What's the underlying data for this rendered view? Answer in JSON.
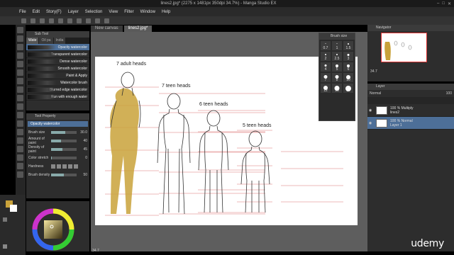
{
  "window": {
    "title": "lines2.jpg* (2275 x 1481px 350dpi 34.7%) - Manga Studio EX"
  },
  "menu": [
    "File",
    "Edit",
    "Story(F)",
    "Layer",
    "Selection",
    "View",
    "Filter",
    "Window",
    "Help"
  ],
  "tabs": [
    {
      "label": "New canvas"
    },
    {
      "label": "lines2.jpg*"
    }
  ],
  "subtool": {
    "title": "Sub Tool",
    "tabs": [
      "Wate",
      "Oil pa",
      "India"
    ],
    "brushes": [
      "Opacity watercolor",
      "Transparent watercolor",
      "Dense watercolor",
      "Smooth watercolor",
      "Paint & Apply",
      "Watercolor brush",
      "Blurred edge watercolor",
      "Run with enough water"
    ]
  },
  "toolprop": {
    "title": "Tool Property",
    "selected": "Opacity watercolor",
    "rows": [
      {
        "label": "Brush size",
        "value": "30.0"
      },
      {
        "label": "Amount of paint",
        "value": "40"
      },
      {
        "label": "Density of paint",
        "value": "45"
      },
      {
        "label": "Color stretch",
        "value": "0"
      },
      {
        "label": "Hardness",
        "value": ""
      },
      {
        "label": "Brush density",
        "value": "50"
      }
    ]
  },
  "brushsize": {
    "title": "Brush size",
    "sizes": [
      "0.7",
      "1",
      "1.5",
      "2",
      "2.5",
      "3",
      "4",
      "5",
      "6",
      "7",
      "8",
      "10",
      "12",
      "15",
      "17"
    ]
  },
  "navigator": {
    "title": "Navigator",
    "zoom": "34.7"
  },
  "layers": {
    "title": "Layer",
    "blend": "Normal",
    "opacity": "100",
    "items": [
      {
        "line1": "100 % Multiply",
        "line2": "lines2",
        "selected": false
      },
      {
        "line1": "100 % Normal",
        "line2": "Layer 1",
        "selected": true
      }
    ]
  },
  "canvas": {
    "labels": [
      "7 adult heads",
      "7 teen heads",
      "6 teen heads",
      "5 teen heads"
    ]
  },
  "colors": {
    "accent": "#4d6f98",
    "skin": "#c9a23a"
  },
  "status": {
    "zoom": "34.7"
  },
  "watermark": "udemy"
}
